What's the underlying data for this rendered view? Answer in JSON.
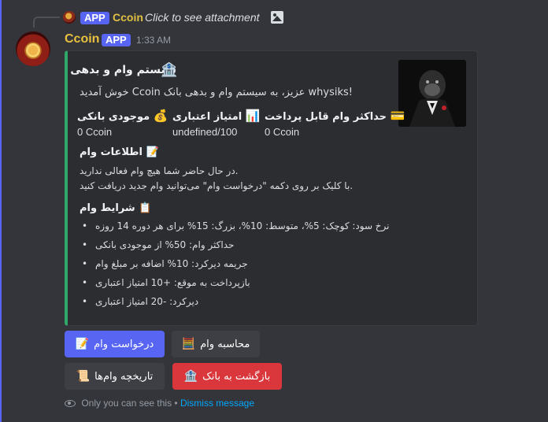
{
  "reply": {
    "badge": "APP",
    "name": "Ccoin",
    "text": "Click to see attachment"
  },
  "message": {
    "author": "Ccoin",
    "badge": "APP",
    "timestamp": "1:33 AM"
  },
  "embed": {
    "accent_color": "#2fa86a",
    "title": "سیستم وام و بدهی",
    "title_icon": "🏦",
    "description": "خوش آمدید Ccoin عزیز، به سیستم وام و بدهی بانک whysiks!",
    "fields": [
      {
        "name": "حداکثر وام قابل پرداخت",
        "icon": "💳",
        "value": "0 Ccoin"
      },
      {
        "name": "امتیاز اعتباری",
        "icon": "📊",
        "value": "undefined/100"
      },
      {
        "name": "موجودی بانکی",
        "icon": "💰",
        "value": "0 Ccoin"
      }
    ],
    "loan_info": {
      "title": "اطلاعات وام",
      "icon": "📝",
      "line1": "در حال حاضر شما هیچ وام فعالی ندارید.",
      "line2": "با کلیک بر روی دکمه \"درخواست وام\" می‌توانید وام جدید دریافت کنید."
    },
    "terms": {
      "title": "شرایط وام",
      "icon": "📋",
      "items": [
        "نرخ سود: کوچک: 5%، متوسط: 10%، بزرگ: 15% برای هر دوره 14 روزه",
        "حداکثر وام: 50% از موجودی بانکی",
        "جریمه دیرکرد: 10% اضافه بر مبلغ وام",
        "بازپرداخت به موقع: +10 امتیاز اعتباری",
        "دیرکرد: -20 امتیاز اعتباری"
      ]
    }
  },
  "buttons": {
    "request_loan": {
      "label": "درخواست وام",
      "icon": "📝"
    },
    "loan_calc": {
      "label": "محاسبه وام",
      "icon": "🧮"
    },
    "loan_history": {
      "label": "تاریخچه وام‌ها",
      "icon": "📜"
    },
    "back_to_bank": {
      "label": "بازگشت به بانک",
      "icon": "🏦"
    }
  },
  "footer": {
    "only_you": "Only you can see this",
    "separator": "•",
    "dismiss": "Dismiss message"
  },
  "colors": {
    "brand": "#5865f2",
    "author": "#e8c13e",
    "danger": "#da373c",
    "link": "#00a8fc"
  }
}
